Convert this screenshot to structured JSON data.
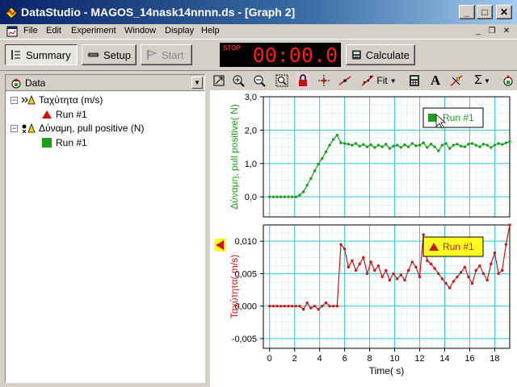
{
  "window": {
    "title": "DataStudio - MAGOS_14nask14nnnn.ds - [Graph 2]",
    "buttons": {
      "minimize": "_",
      "maximize": "□",
      "close": "✕"
    }
  },
  "menu": {
    "items": [
      "File",
      "Edit",
      "Experiment",
      "Window",
      "Display",
      "Help"
    ],
    "mdi": {
      "minimize": "_",
      "restore": "❐",
      "close": "✕"
    }
  },
  "toolbar": {
    "summary": "Summary",
    "setup": "Setup",
    "start": "Start",
    "timer_status": "STOP",
    "timer_value": "00:00.0",
    "calculate": "Calculate"
  },
  "data_panel": {
    "header": "Data",
    "items": [
      {
        "label": "Ταχύτητα (m/s)",
        "run": "Run #1",
        "marker_color": "#d01010",
        "marker": "triangle"
      },
      {
        "label": "Δύναμη, pull positive (N)",
        "run": "Run #1",
        "marker_color": "#18a018",
        "marker": "square"
      }
    ]
  },
  "graph_toolbar": {
    "fit_label": "Fit",
    "icons": [
      "scale-to-fit-icon",
      "zoom-in-icon",
      "zoom-out-icon",
      "zoom-select-icon",
      "lock-icon",
      "smart-tool-icon",
      "slope-icon",
      "fit-icon",
      "calculator-icon",
      "annotation-icon",
      "prediction-icon",
      "statistics-icon",
      "data-icon"
    ]
  },
  "colors": {
    "force": "#1e9e1e",
    "velocity": "#c81818",
    "grid_major": "#35c8d6",
    "grid_minor": "#d8eef2",
    "legend_bg": "#ffff20"
  },
  "chart_data": [
    {
      "type": "line",
      "ylabel": "Δύναμη, pull positive( N)",
      "ylim": [
        -0.6,
        3.0
      ],
      "yticks": [
        "3,0",
        "2,0",
        "1,0",
        "0,0"
      ],
      "ytick_values": [
        3.0,
        2.0,
        1.0,
        0.0
      ],
      "xlim": [
        -0.5,
        19.2
      ],
      "legend": "Run #1",
      "legend_placement": "top-right",
      "series": [
        {
          "name": "Run #1",
          "x": [
            0,
            0.3,
            0.6,
            0.9,
            1.2,
            1.5,
            1.8,
            2.1,
            2.4,
            2.7,
            3.0,
            3.3,
            3.6,
            3.9,
            4.2,
            4.5,
            4.8,
            5.1,
            5.4,
            5.7,
            6.0,
            6.3,
            6.6,
            6.9,
            7.2,
            7.5,
            7.8,
            8.1,
            8.4,
            8.7,
            9.0,
            9.3,
            9.6,
            9.9,
            10.2,
            10.5,
            10.8,
            11.1,
            11.4,
            11.7,
            12.0,
            12.3,
            12.6,
            12.9,
            13.2,
            13.5,
            13.8,
            14.1,
            14.4,
            14.7,
            15.0,
            15.3,
            15.6,
            15.9,
            16.2,
            16.5,
            16.8,
            17.1,
            17.4,
            17.7,
            18.0,
            18.3,
            18.6,
            18.9,
            19.2
          ],
          "y": [
            0.0,
            0.0,
            0.0,
            0.0,
            0.0,
            0.0,
            0.0,
            0.0,
            0.05,
            0.15,
            0.35,
            0.55,
            0.78,
            0.98,
            1.15,
            1.35,
            1.55,
            1.72,
            1.85,
            1.62,
            1.6,
            1.58,
            1.55,
            1.6,
            1.52,
            1.57,
            1.5,
            1.56,
            1.48,
            1.55,
            1.5,
            1.58,
            1.45,
            1.52,
            1.55,
            1.48,
            1.56,
            1.5,
            1.6,
            1.53,
            1.55,
            1.62,
            1.48,
            1.58,
            1.5,
            1.38,
            1.55,
            1.6,
            1.45,
            1.55,
            1.58,
            1.52,
            1.5,
            1.58,
            1.6,
            1.55,
            1.5,
            1.58,
            1.55,
            1.48,
            1.55,
            1.6,
            1.57,
            1.62,
            1.65
          ]
        }
      ]
    },
    {
      "type": "line",
      "ylabel": "Ταχύτητα( m/s)",
      "xlabel": "Time( s)",
      "ylim": [
        -0.0065,
        0.0125
      ],
      "yticks": [
        "0,010",
        "0,005",
        "0,000",
        "-0,005"
      ],
      "ytick_values": [
        0.01,
        0.005,
        0.0,
        -0.005
      ],
      "xlim": [
        -0.5,
        19.2
      ],
      "xticks": [
        "0",
        "2",
        "4",
        "6",
        "8",
        "10",
        "12",
        "14",
        "16",
        "18"
      ],
      "legend": "Run #1",
      "legend_placement": "top-right",
      "series": [
        {
          "name": "Run #1",
          "x": [
            0,
            0.3,
            0.6,
            0.9,
            1.2,
            1.5,
            1.8,
            2.1,
            2.4,
            2.7,
            3.0,
            3.3,
            3.6,
            3.9,
            4.2,
            4.5,
            4.8,
            5.1,
            5.4,
            5.7,
            6.0,
            6.3,
            6.6,
            6.9,
            7.2,
            7.5,
            7.8,
            8.1,
            8.4,
            8.7,
            9.0,
            9.3,
            9.6,
            9.9,
            10.2,
            10.5,
            10.8,
            11.1,
            11.4,
            11.7,
            12.0,
            12.3,
            12.6,
            12.9,
            13.2,
            13.5,
            13.8,
            14.1,
            14.4,
            14.7,
            15.0,
            15.3,
            15.6,
            15.9,
            16.2,
            16.5,
            16.8,
            17.1,
            17.4,
            17.7,
            18.0,
            18.3,
            18.6,
            18.9,
            19.2
          ],
          "y": [
            0.0,
            0.0,
            0.0,
            0.0,
            0.0,
            0.0,
            0.0,
            0.0,
            0.0,
            -0.0005,
            0.0005,
            -0.0003,
            0.0,
            -0.0005,
            0.0,
            0.0005,
            0.0,
            0.0,
            0.0,
            0.0095,
            0.0088,
            0.006,
            0.007,
            0.0055,
            0.0065,
            0.0075,
            0.005,
            0.0068,
            0.0055,
            0.0062,
            0.0045,
            0.0055,
            0.004,
            0.005,
            0.0042,
            0.0048,
            0.004,
            0.0055,
            0.0068,
            0.006,
            0.0045,
            0.011,
            0.007,
            0.0065,
            0.0058,
            0.005,
            0.0042,
            0.0035,
            0.0028,
            0.0038,
            0.0045,
            0.0052,
            0.006,
            0.0045,
            0.0035,
            0.0055,
            0.0062,
            0.005,
            0.004,
            0.0065,
            0.0082,
            0.005,
            0.0055,
            0.0095,
            0.0125
          ]
        }
      ]
    }
  ]
}
